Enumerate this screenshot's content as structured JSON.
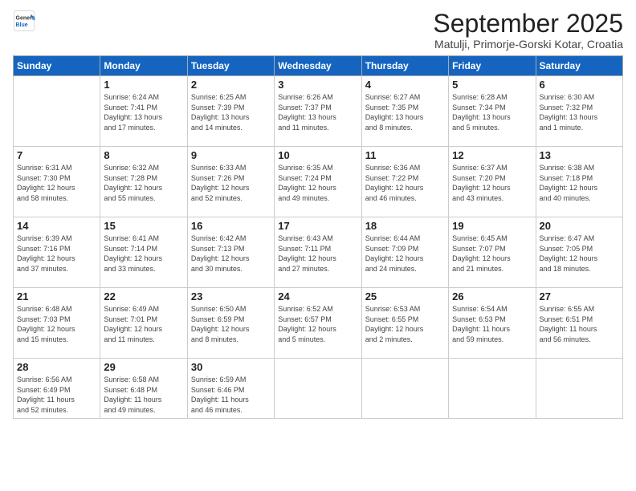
{
  "logo": {
    "general": "General",
    "blue": "Blue"
  },
  "title": "September 2025",
  "location": "Matulji, Primorje-Gorski Kotar, Croatia",
  "days_of_week": [
    "Sunday",
    "Monday",
    "Tuesday",
    "Wednesday",
    "Thursday",
    "Friday",
    "Saturday"
  ],
  "weeks": [
    [
      {
        "num": "",
        "info": ""
      },
      {
        "num": "1",
        "info": "Sunrise: 6:24 AM\nSunset: 7:41 PM\nDaylight: 13 hours\nand 17 minutes."
      },
      {
        "num": "2",
        "info": "Sunrise: 6:25 AM\nSunset: 7:39 PM\nDaylight: 13 hours\nand 14 minutes."
      },
      {
        "num": "3",
        "info": "Sunrise: 6:26 AM\nSunset: 7:37 PM\nDaylight: 13 hours\nand 11 minutes."
      },
      {
        "num": "4",
        "info": "Sunrise: 6:27 AM\nSunset: 7:35 PM\nDaylight: 13 hours\nand 8 minutes."
      },
      {
        "num": "5",
        "info": "Sunrise: 6:28 AM\nSunset: 7:34 PM\nDaylight: 13 hours\nand 5 minutes."
      },
      {
        "num": "6",
        "info": "Sunrise: 6:30 AM\nSunset: 7:32 PM\nDaylight: 13 hours\nand 1 minute."
      }
    ],
    [
      {
        "num": "7",
        "info": "Sunrise: 6:31 AM\nSunset: 7:30 PM\nDaylight: 12 hours\nand 58 minutes."
      },
      {
        "num": "8",
        "info": "Sunrise: 6:32 AM\nSunset: 7:28 PM\nDaylight: 12 hours\nand 55 minutes."
      },
      {
        "num": "9",
        "info": "Sunrise: 6:33 AM\nSunset: 7:26 PM\nDaylight: 12 hours\nand 52 minutes."
      },
      {
        "num": "10",
        "info": "Sunrise: 6:35 AM\nSunset: 7:24 PM\nDaylight: 12 hours\nand 49 minutes."
      },
      {
        "num": "11",
        "info": "Sunrise: 6:36 AM\nSunset: 7:22 PM\nDaylight: 12 hours\nand 46 minutes."
      },
      {
        "num": "12",
        "info": "Sunrise: 6:37 AM\nSunset: 7:20 PM\nDaylight: 12 hours\nand 43 minutes."
      },
      {
        "num": "13",
        "info": "Sunrise: 6:38 AM\nSunset: 7:18 PM\nDaylight: 12 hours\nand 40 minutes."
      }
    ],
    [
      {
        "num": "14",
        "info": "Sunrise: 6:39 AM\nSunset: 7:16 PM\nDaylight: 12 hours\nand 37 minutes."
      },
      {
        "num": "15",
        "info": "Sunrise: 6:41 AM\nSunset: 7:14 PM\nDaylight: 12 hours\nand 33 minutes."
      },
      {
        "num": "16",
        "info": "Sunrise: 6:42 AM\nSunset: 7:13 PM\nDaylight: 12 hours\nand 30 minutes."
      },
      {
        "num": "17",
        "info": "Sunrise: 6:43 AM\nSunset: 7:11 PM\nDaylight: 12 hours\nand 27 minutes."
      },
      {
        "num": "18",
        "info": "Sunrise: 6:44 AM\nSunset: 7:09 PM\nDaylight: 12 hours\nand 24 minutes."
      },
      {
        "num": "19",
        "info": "Sunrise: 6:45 AM\nSunset: 7:07 PM\nDaylight: 12 hours\nand 21 minutes."
      },
      {
        "num": "20",
        "info": "Sunrise: 6:47 AM\nSunset: 7:05 PM\nDaylight: 12 hours\nand 18 minutes."
      }
    ],
    [
      {
        "num": "21",
        "info": "Sunrise: 6:48 AM\nSunset: 7:03 PM\nDaylight: 12 hours\nand 15 minutes."
      },
      {
        "num": "22",
        "info": "Sunrise: 6:49 AM\nSunset: 7:01 PM\nDaylight: 12 hours\nand 11 minutes."
      },
      {
        "num": "23",
        "info": "Sunrise: 6:50 AM\nSunset: 6:59 PM\nDaylight: 12 hours\nand 8 minutes."
      },
      {
        "num": "24",
        "info": "Sunrise: 6:52 AM\nSunset: 6:57 PM\nDaylight: 12 hours\nand 5 minutes."
      },
      {
        "num": "25",
        "info": "Sunrise: 6:53 AM\nSunset: 6:55 PM\nDaylight: 12 hours\nand 2 minutes."
      },
      {
        "num": "26",
        "info": "Sunrise: 6:54 AM\nSunset: 6:53 PM\nDaylight: 11 hours\nand 59 minutes."
      },
      {
        "num": "27",
        "info": "Sunrise: 6:55 AM\nSunset: 6:51 PM\nDaylight: 11 hours\nand 56 minutes."
      }
    ],
    [
      {
        "num": "28",
        "info": "Sunrise: 6:56 AM\nSunset: 6:49 PM\nDaylight: 11 hours\nand 52 minutes."
      },
      {
        "num": "29",
        "info": "Sunrise: 6:58 AM\nSunset: 6:48 PM\nDaylight: 11 hours\nand 49 minutes."
      },
      {
        "num": "30",
        "info": "Sunrise: 6:59 AM\nSunset: 6:46 PM\nDaylight: 11 hours\nand 46 minutes."
      },
      {
        "num": "",
        "info": ""
      },
      {
        "num": "",
        "info": ""
      },
      {
        "num": "",
        "info": ""
      },
      {
        "num": "",
        "info": ""
      }
    ]
  ]
}
